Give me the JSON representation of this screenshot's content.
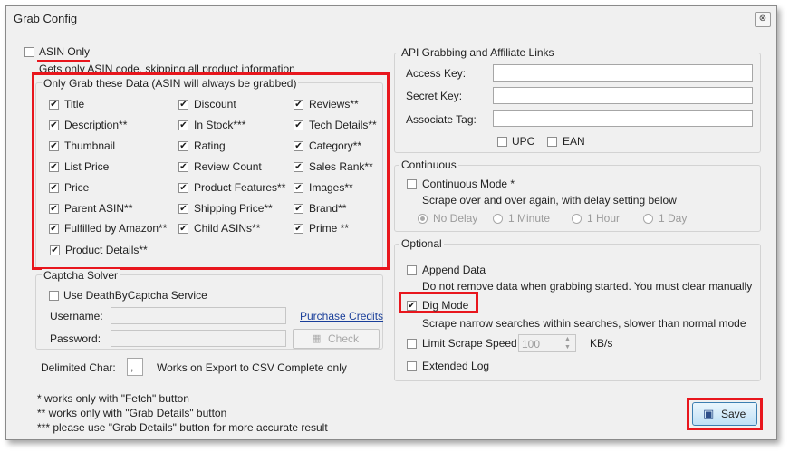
{
  "window": {
    "title": "Grab Config",
    "close_glyph": "⊗"
  },
  "asin_only": {
    "label": "ASIN Only",
    "checked": false,
    "desc": "Gets only ASIN code, skipping all product information"
  },
  "grab_group": {
    "title": "Only Grab these Data (ASIN will always be grabbed)",
    "items": [
      {
        "label": "Title",
        "checked": true
      },
      {
        "label": "Description**",
        "checked": true
      },
      {
        "label": "Thumbnail",
        "checked": true
      },
      {
        "label": "List Price",
        "checked": true
      },
      {
        "label": "Price",
        "checked": true
      },
      {
        "label": "Parent ASIN**",
        "checked": true
      },
      {
        "label": "Fulfilled by Amazon**",
        "checked": true
      },
      {
        "label": "Product Details**",
        "checked": true
      },
      {
        "label": "Discount",
        "checked": true
      },
      {
        "label": "In Stock***",
        "checked": true
      },
      {
        "label": "Rating",
        "checked": true
      },
      {
        "label": "Review Count",
        "checked": true
      },
      {
        "label": "Product Features**",
        "checked": true
      },
      {
        "label": "Shipping Price**",
        "checked": true
      },
      {
        "label": "Child ASINs**",
        "checked": true
      },
      {
        "label": "Reviews**",
        "checked": true
      },
      {
        "label": "Tech Details**",
        "checked": true
      },
      {
        "label": "Category**",
        "checked": true
      },
      {
        "label": "Sales Rank**",
        "checked": true
      },
      {
        "label": "Images**",
        "checked": true
      },
      {
        "label": "Brand**",
        "checked": true
      },
      {
        "label": "Prime **",
        "checked": true
      }
    ]
  },
  "captcha": {
    "title": "Captcha Solver",
    "use_label": "Use DeathByCaptcha Service",
    "username_label": "Username:",
    "password_label": "Password:",
    "purchase_link": "Purchase Credits",
    "check_button": "Check",
    "check_icon": "▦"
  },
  "delimited": {
    "label": "Delimited Char:",
    "value": ",",
    "note": "Works on Export to CSV Complete only"
  },
  "notes": [
    "* works only with \"Fetch\" button",
    "** works only with \"Grab Details\" button",
    "*** please use \"Grab Details\" button for more accurate result"
  ],
  "api": {
    "title": "API Grabbing and Affiliate Links",
    "access_key_label": "Access Key:",
    "secret_key_label": "Secret Key:",
    "associate_tag_label": "Associate Tag:",
    "upc_label": "UPC",
    "ean_label": "EAN"
  },
  "continuous": {
    "title": "Continuous",
    "mode_label": "Continuous Mode *",
    "desc": "Scrape over and over again, with delay setting below",
    "delays": [
      "No Delay",
      "1 Minute",
      "1 Hour",
      "1 Day"
    ],
    "selected_delay": "No Delay"
  },
  "optional": {
    "title": "Optional",
    "append_label": "Append Data",
    "append_desc": "Do not remove data when grabbing started. You must clear manually",
    "dig_label": "Dig Mode",
    "dig_checked": true,
    "dig_desc": "Scrape narrow searches within searches, slower than normal mode",
    "limit_label": "Limit Scrape Speed",
    "limit_value": "100",
    "limit_unit": "KB/s",
    "extended_label": "Extended Log"
  },
  "save_button": {
    "label": "Save",
    "icon": "▣"
  },
  "accent": {
    "highlight_red": "#e8161d",
    "link_blue": "#1a3f9a"
  }
}
